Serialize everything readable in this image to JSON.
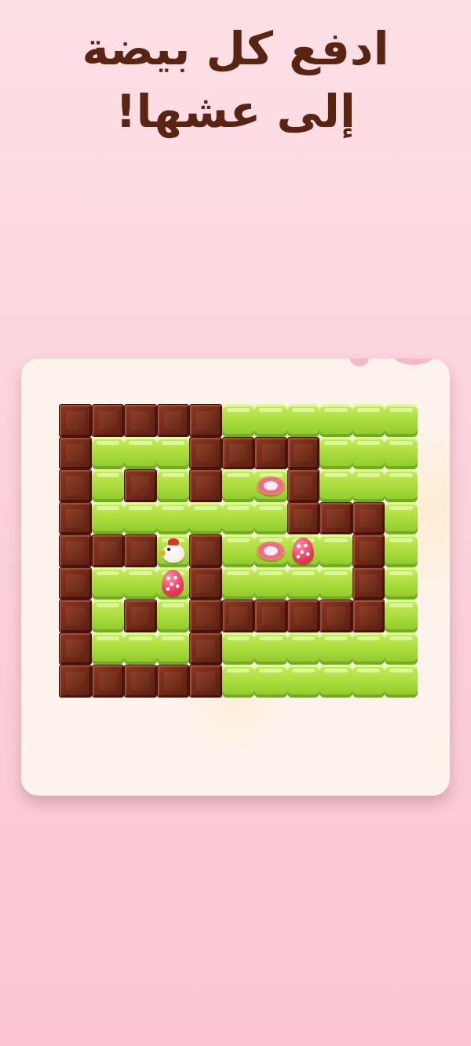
{
  "headline": {
    "line1": "ادفع كل بيضة",
    "line2": "إلى عشها!"
  },
  "colors": {
    "background_top": "#fde0e6",
    "background_bottom": "#fcc6d3",
    "panel": "#fdf3ec",
    "headline_text": "#5a2412",
    "wall": "#6e2717",
    "floor": "#a8db3a",
    "egg": "#e83a5c",
    "nest": "#f06a8e"
  },
  "legend": {
    "W": "chocolate-wall",
    "F": "grass-floor",
    "E": "egg-on-floor",
    "N": "nest-target",
    "C": "chicken-player"
  },
  "board": {
    "rows": [
      "WWWWWFFFFFF",
      "WFFFWWWWFFF",
      "WFWFWFNWFFF",
      "WFFFFFFWWWF",
      "WWWCWFNEFWF",
      "WFFEWFFFFWF",
      "WFWFWWWWWWF",
      "WFFFWFFFFFF",
      "WWWWWFFFFFF"
    ]
  }
}
